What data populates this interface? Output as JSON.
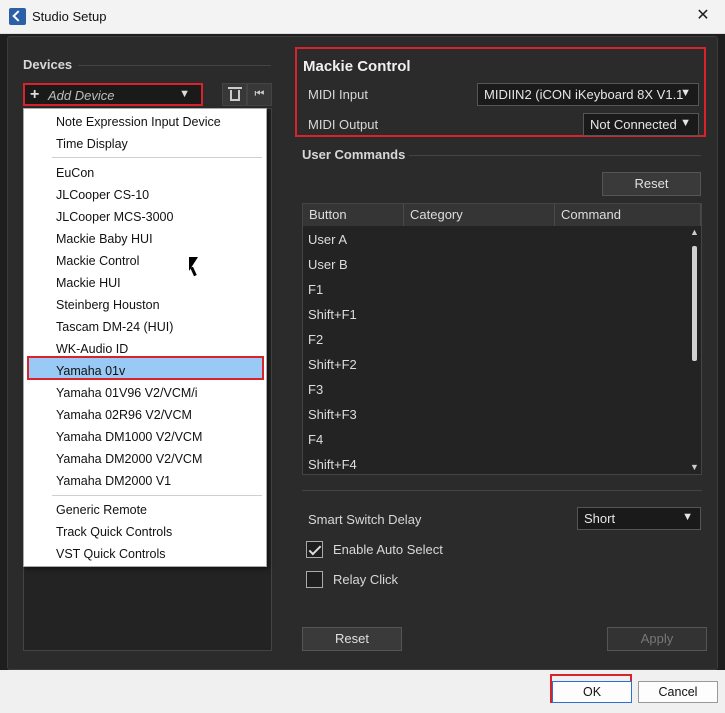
{
  "window": {
    "title": "Studio Setup",
    "close": "✕"
  },
  "devices": {
    "label": "Devices",
    "add_device_label": "Add Device",
    "add_icon": "+",
    "caret": "▼",
    "skip_icon": "⏮"
  },
  "dropdown": {
    "group1": [
      "Note Expression Input Device",
      "Time Display"
    ],
    "group2": [
      "EuCon",
      "JLCooper CS-10",
      "JLCooper MCS-3000",
      "Mackie Baby HUI",
      "Mackie Control",
      "Mackie HUI",
      "Steinberg Houston",
      "Tascam DM-24 (HUI)",
      "WK-Audio ID",
      "Yamaha 01v",
      "Yamaha 01V96 V2/VCM/i",
      "Yamaha 02R96 V2/VCM",
      "Yamaha DM1000 V2/VCM",
      "Yamaha DM2000 V2/VCM",
      "Yamaha DM2000 V1"
    ],
    "group3": [
      "Generic Remote",
      "Track Quick Controls",
      "VST Quick Controls"
    ],
    "selected": "Mackie Control"
  },
  "mackie": {
    "title": "Mackie Control",
    "midi_input_label": "MIDI Input",
    "midi_input_value": "MIDIIN2 (iCON iKeyboard 8X V1.1",
    "midi_output_label": "MIDI Output",
    "midi_output_value": "Not Connected"
  },
  "user_commands": {
    "label": "User Commands",
    "reset_label": "Reset",
    "columns": [
      "Button",
      "Category",
      "Command"
    ],
    "rows": [
      "User A",
      "User B",
      "F1",
      "Shift+F1",
      "F2",
      "Shift+F2",
      "F3",
      "Shift+F3",
      "F4",
      "Shift+F4"
    ]
  },
  "options": {
    "smart_switch_label": "Smart Switch Delay",
    "smart_switch_value": "Short",
    "enable_auto_select_label": "Enable Auto Select",
    "enable_auto_select_checked": true,
    "relay_click_label": "Relay Click",
    "relay_click_checked": false
  },
  "bottom": {
    "reset_label": "Reset",
    "apply_label": "Apply"
  },
  "footer": {
    "ok_label": "OK",
    "cancel_label": "Cancel"
  },
  "colors": {
    "highlight_red": "#d9232a",
    "selection_blue": "#99c9f5"
  }
}
